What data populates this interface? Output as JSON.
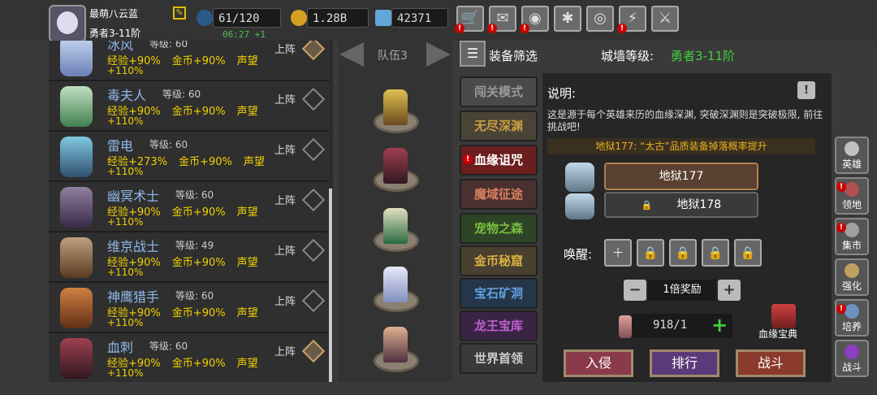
{
  "player": {
    "name": "最萌八云蓝",
    "rank": "勇者3-11阶"
  },
  "resources": {
    "energy": "61/120",
    "timer": "06:27 +1",
    "gold": "1.28B",
    "gems": "42371"
  },
  "toolbar_icons": [
    "shop-cart-icon",
    "mail-icon",
    "gamepad-icon",
    "gear-icon",
    "color-wheel-icon",
    "stats-icon",
    "swords-icon"
  ],
  "heroes": [
    {
      "name": "冰风",
      "level": "等级: 60",
      "exp": "经验+90%",
      "gold": "金币+90%",
      "fame": "声望",
      "fame_val": "+110%",
      "deploy": "上阵",
      "active": true
    },
    {
      "name": "毒夫人",
      "level": "等级: 60",
      "exp": "经验+90%",
      "gold": "金币+90%",
      "fame": "声望",
      "fame_val": "+110%",
      "deploy": "上阵",
      "active": false
    },
    {
      "name": "雷电",
      "level": "等级: 60",
      "exp": "经验+273%",
      "gold": "金币+90%",
      "fame": "声望",
      "fame_val": "+110%",
      "deploy": "上阵",
      "active": false
    },
    {
      "name": "幽冥术士",
      "level": "等级: 60",
      "exp": "经验+90%",
      "gold": "金币+90%",
      "fame": "声望",
      "fame_val": "+110%",
      "deploy": "上阵",
      "active": false
    },
    {
      "name": "维京战士",
      "level": "等级: 49",
      "exp": "经验+90%",
      "gold": "金币+90%",
      "fame": "声望",
      "fame_val": "+110%",
      "deploy": "上阵",
      "active": false
    },
    {
      "name": "神鹰猎手",
      "level": "等级: 60",
      "exp": "经验+90%",
      "gold": "金币+90%",
      "fame": "声望",
      "fame_val": "+110%",
      "deploy": "上阵",
      "active": false
    },
    {
      "name": "血刺",
      "level": "等级: 60",
      "exp": "经验+90%",
      "gold": "金币+90%",
      "fame": "声望",
      "fame_val": "+110%",
      "deploy": "上阵",
      "active": true
    }
  ],
  "team": {
    "label": "队伍3"
  },
  "equip_filter": "装备筛选",
  "wall": {
    "label": "城墙等级:",
    "value": "勇者3-11阶"
  },
  "modes": [
    {
      "label": "闯关模式",
      "color": "#9a9a9a",
      "bg": "#4a4a4a"
    },
    {
      "label": "无尽深渊",
      "color": "#c9a040",
      "bg": "#4a4436"
    },
    {
      "label": "血缘诅咒",
      "color": "#ffffff",
      "bg": "#6a1e1e",
      "alert": true
    },
    {
      "label": "魔域征途",
      "color": "#d98060",
      "bg": "#4a3030"
    },
    {
      "label": "宠物之森",
      "color": "#7ac040",
      "bg": "#2e4426"
    },
    {
      "label": "金币秘窟",
      "color": "#d8b040",
      "bg": "#4a4030"
    },
    {
      "label": "宝石矿洞",
      "color": "#60a0e0",
      "bg": "#26364a"
    },
    {
      "label": "龙王宝库",
      "color": "#c060d0",
      "bg": "#3a2446"
    },
    {
      "label": "世界首领",
      "color": "#cccccc",
      "bg": "#3a3a3a"
    }
  ],
  "desc": {
    "title": "说明:",
    "text": "这是源于每个英雄来历的血缘深渊, 突破深渊则是突破极限, 前往挑战吧!",
    "banner": "地狱177: “太古”品质装备掉落概率提升"
  },
  "levels": [
    {
      "label": "地狱177",
      "locked": false
    },
    {
      "label": "地狱178",
      "locked": true
    }
  ],
  "awaken": {
    "label": "唤醒:"
  },
  "reward": {
    "label": "1倍奖励"
  },
  "key_count": "918/1",
  "codex": "血缘宝典",
  "actions": {
    "invade": "入侵",
    "rank": "排行",
    "fight": "战斗"
  },
  "side": [
    {
      "label": "英雄",
      "alert": false
    },
    {
      "label": "领地",
      "alert": true
    },
    {
      "label": "集市",
      "alert": true
    },
    {
      "label": "强化",
      "alert": false
    },
    {
      "label": "培养",
      "alert": true
    },
    {
      "label": "战斗",
      "alert": false
    }
  ]
}
